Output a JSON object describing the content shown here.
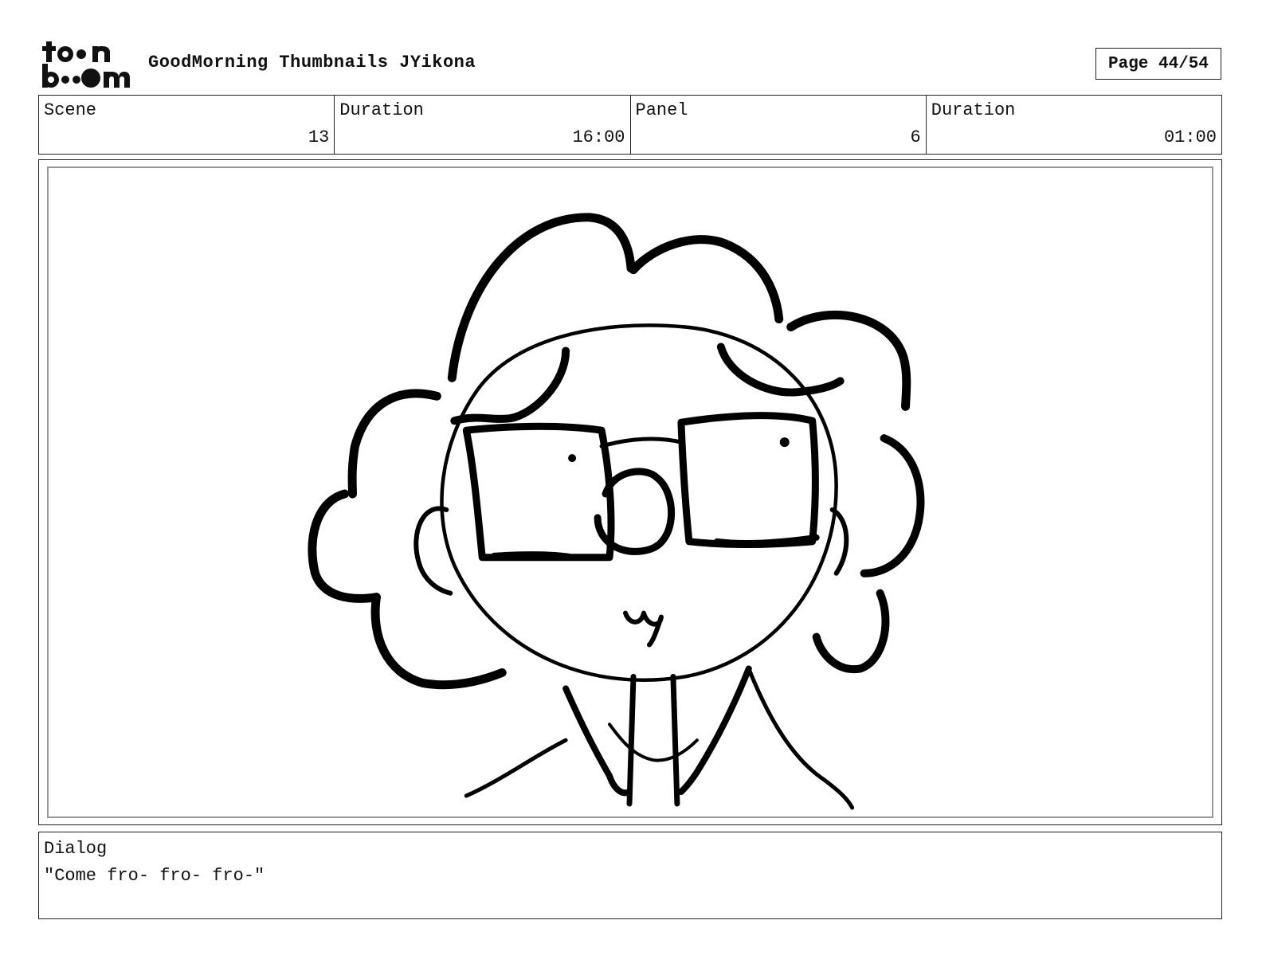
{
  "header": {
    "logo_text_top": "to•n",
    "logo_text_bottom": "b••m",
    "title": "GoodMorning Thumbnails JYikona",
    "page": "Page 44/54"
  },
  "info": [
    {
      "label": "Scene",
      "value": "13"
    },
    {
      "label": "Duration",
      "value": "16:00"
    },
    {
      "label": "Panel",
      "value": "6"
    },
    {
      "label": "Duration",
      "value": "01:00"
    }
  ],
  "dialog": {
    "label": "Dialog",
    "text": "\"Come fro- fro- fro-\""
  }
}
